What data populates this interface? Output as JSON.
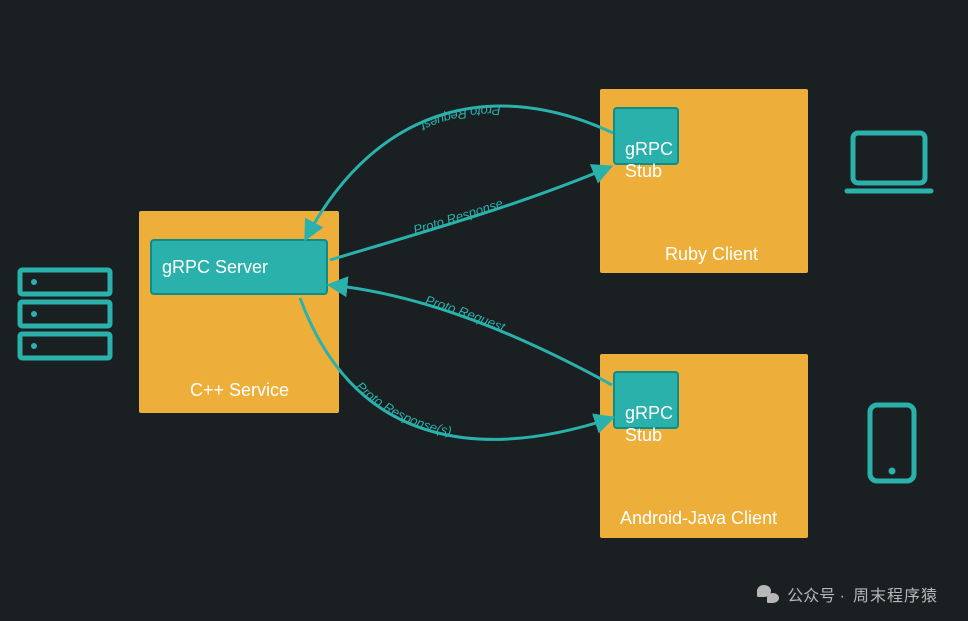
{
  "server": {
    "box_label": "gRPC Server",
    "caption": "C++ Service"
  },
  "clients": [
    {
      "stub_label": "gRPC\nStub",
      "caption": "Ruby Client"
    },
    {
      "stub_label": "gRPC\nStub",
      "caption": "Android-Java Client"
    }
  ],
  "flows": [
    {
      "label": "Proto Request"
    },
    {
      "label": "Proto Response"
    },
    {
      "label": "Proto Request"
    },
    {
      "label": "Proto Response(s)"
    }
  ],
  "footer": {
    "prefix": "公众号 ·",
    "name": "周末程序猿"
  },
  "colors": {
    "accent": "#2bb1ac",
    "box": "#eeaf3a",
    "bg": "#1a1f21"
  }
}
